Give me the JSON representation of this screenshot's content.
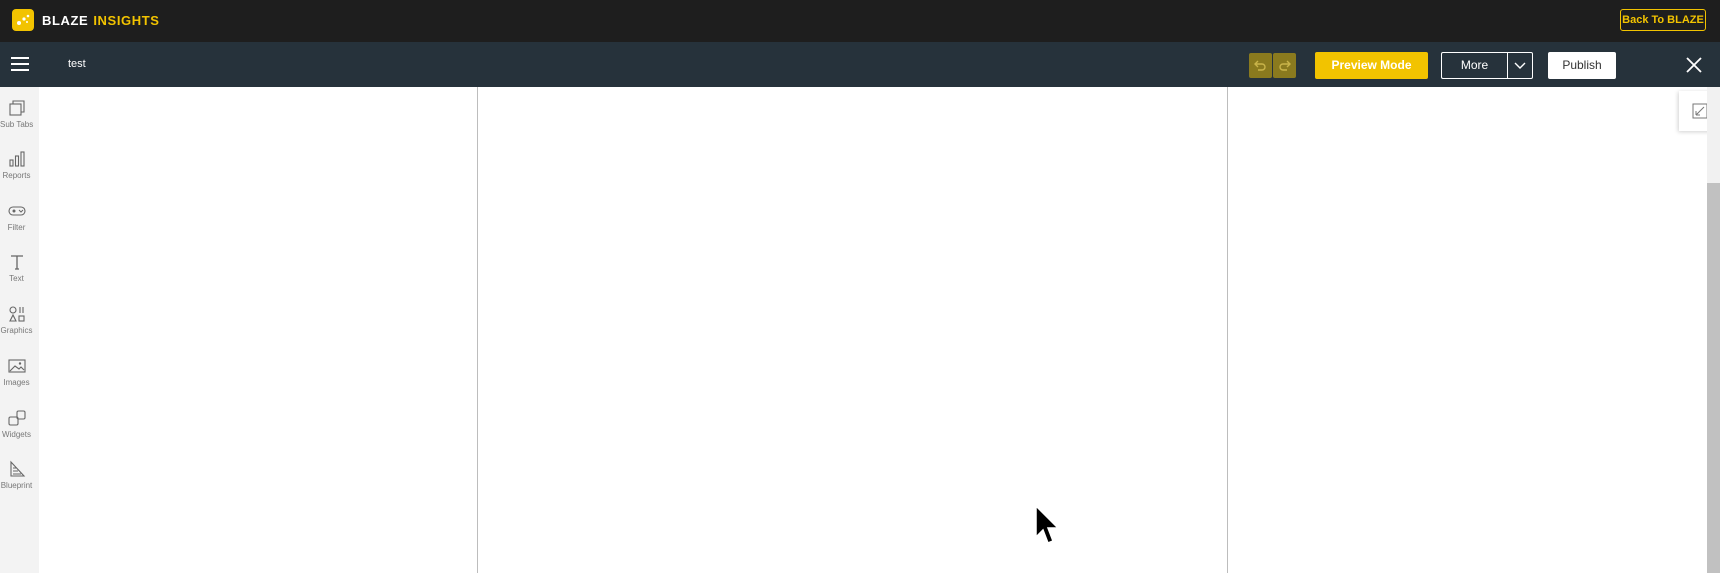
{
  "topbar": {
    "brand_primary": "BLAZE",
    "brand_accent": "INSIGHTS",
    "back_button": "Back To BLAZE",
    "logo_icon": "blaze-logo-icon"
  },
  "toolbar": {
    "menu_icon": "hamburger-menu-icon",
    "document_name": "test",
    "undo_icon": "undo-icon",
    "redo_icon": "redo-icon",
    "preview_button": "Preview Mode",
    "more_button": "More",
    "more_dropdown_icon": "chevron-down-icon",
    "publish_button": "Publish",
    "close_icon": "close-icon"
  },
  "sidebar": {
    "items": [
      {
        "label": "Sub Tabs",
        "icon": "sub-tabs-icon"
      },
      {
        "label": "Reports",
        "icon": "bar-chart-icon"
      },
      {
        "label": "Filter",
        "icon": "filter-icon"
      },
      {
        "label": "Text",
        "icon": "text-icon"
      },
      {
        "label": "Graphics",
        "icon": "shapes-icon"
      },
      {
        "label": "Images",
        "icon": "image-icon"
      },
      {
        "label": "Widgets",
        "icon": "widgets-icon"
      },
      {
        "label": "Blueprint",
        "icon": "blueprint-icon"
      }
    ]
  },
  "canvas": {
    "resize_icon": "collapse-icon"
  },
  "colors": {
    "topbar_bg": "#1e1e1e",
    "toolbar_bg": "#26323b",
    "accent_yellow": "#f2c300",
    "sidebar_bg": "#f3f3f3"
  }
}
